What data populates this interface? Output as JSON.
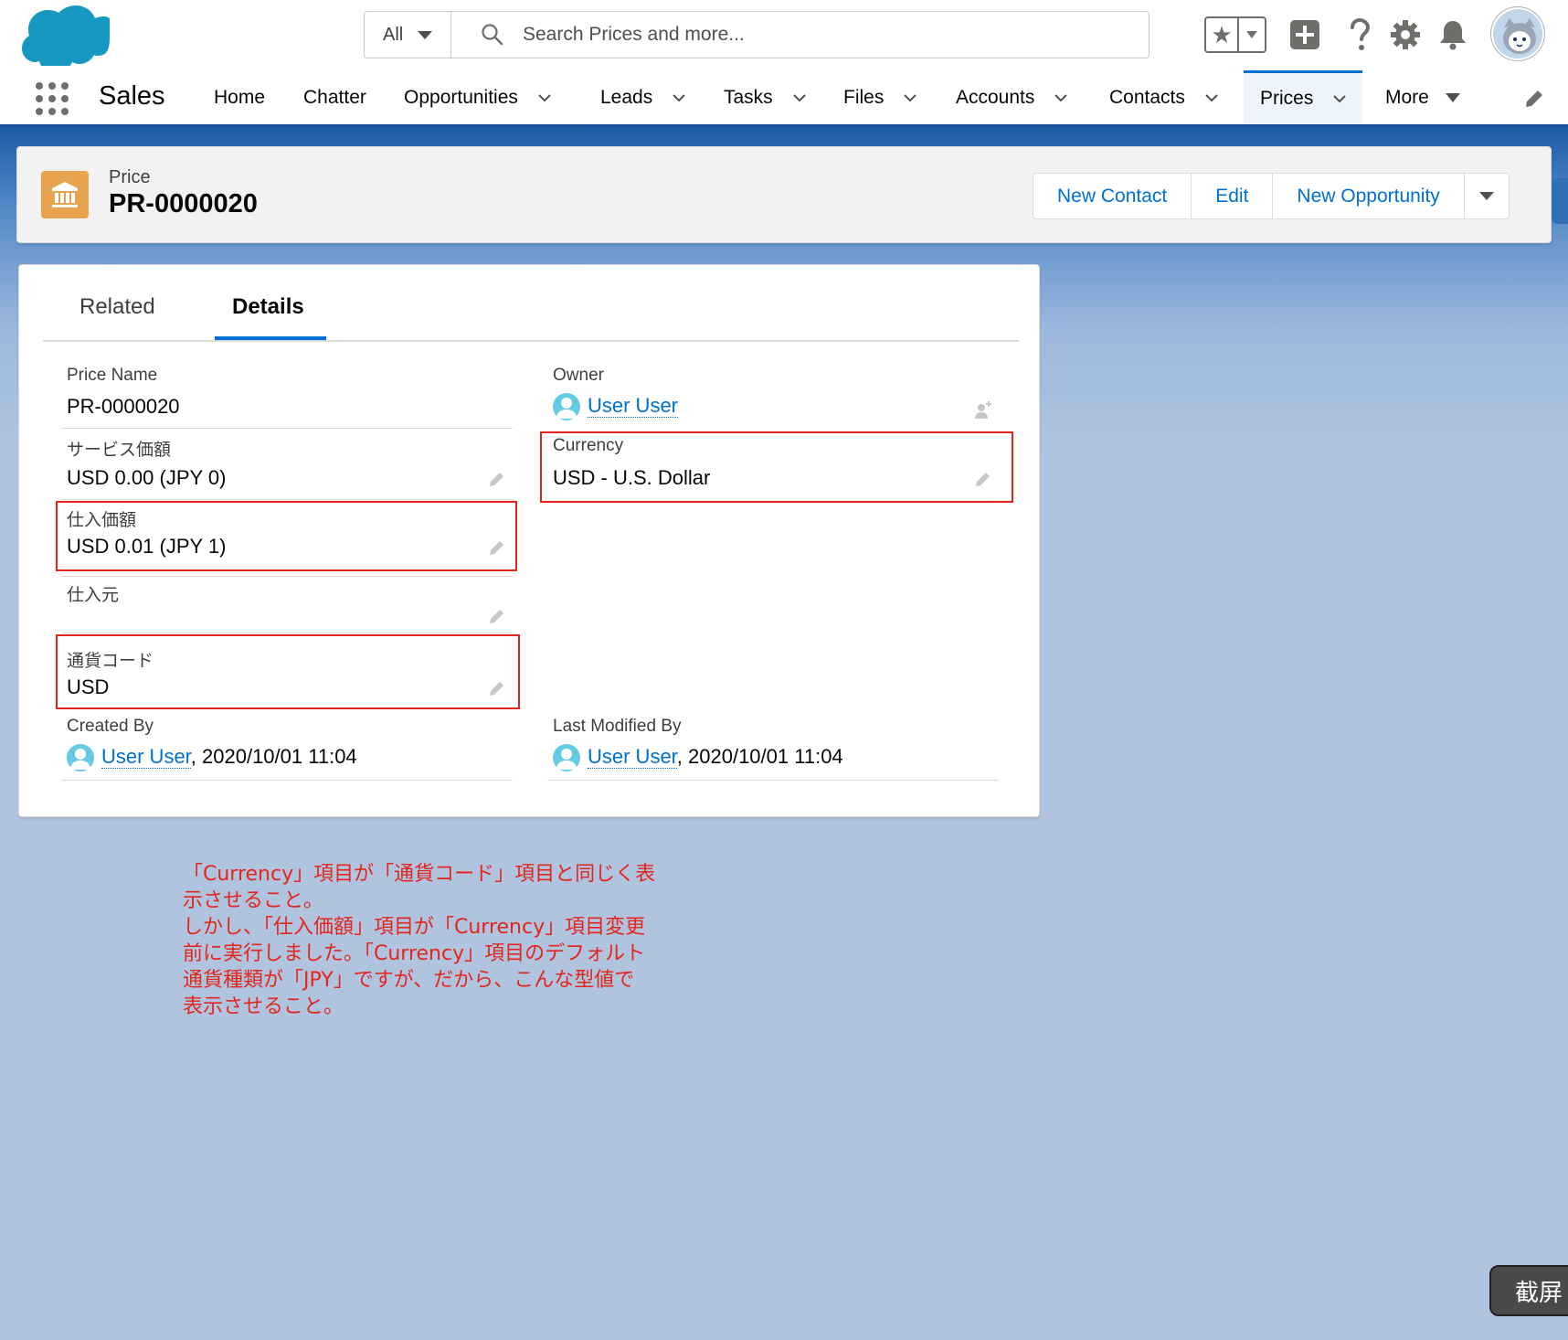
{
  "header": {
    "search_scope": "All",
    "search_placeholder": "Search Prices and more..."
  },
  "nav": {
    "app_name": "Sales",
    "items": [
      {
        "label": "Home"
      },
      {
        "label": "Chatter"
      },
      {
        "label": "Opportunities"
      },
      {
        "label": "Leads"
      },
      {
        "label": "Tasks"
      },
      {
        "label": "Files"
      },
      {
        "label": "Accounts"
      },
      {
        "label": "Contacts"
      },
      {
        "label": "Prices"
      },
      {
        "label": "More"
      }
    ]
  },
  "record": {
    "type": "Price",
    "title": "PR-0000020",
    "actions": [
      "New Contact",
      "Edit",
      "New Opportunity"
    ]
  },
  "tabs": [
    "Related",
    "Details"
  ],
  "fields": {
    "price_name": {
      "label": "Price Name",
      "value": "PR-0000020"
    },
    "owner": {
      "label": "Owner",
      "value": "User User"
    },
    "service_price": {
      "label": "サービス価額",
      "value": "USD 0.00 (JPY 0)"
    },
    "currency": {
      "label": "Currency",
      "value": "USD - U.S. Dollar"
    },
    "purchase_price": {
      "label": "仕入価額",
      "value": "USD 0.01 (JPY 1)"
    },
    "supplier": {
      "label": "仕入元",
      "value": ""
    },
    "currency_code": {
      "label": "通貨コード",
      "value": "USD"
    },
    "created_by": {
      "label": "Created By",
      "user": "User User",
      "date": ", 2020/10/01 11:04"
    },
    "last_modified_by": {
      "label": "Last Modified By",
      "user": "User User",
      "date": ", 2020/10/01 11:04"
    }
  },
  "annotation": [
    "「Currency」項目が「通貨コード」項目と同じく表",
    "示させること。",
    "しかし、「仕入価額」項目が「Currency」項目変更",
    "前に実行しました。「Currency」項目のデフォルト",
    "通貨種類が「JPY」ですが、だから、こんな型値で",
    "表示させること。"
  ],
  "screenshot_button": "截屏",
  "colors": {
    "brand_blue": "#0070d2",
    "highlight_red": "#e4251c",
    "record_icon": "#e8a34e",
    "page_background": "#b0c4df"
  }
}
